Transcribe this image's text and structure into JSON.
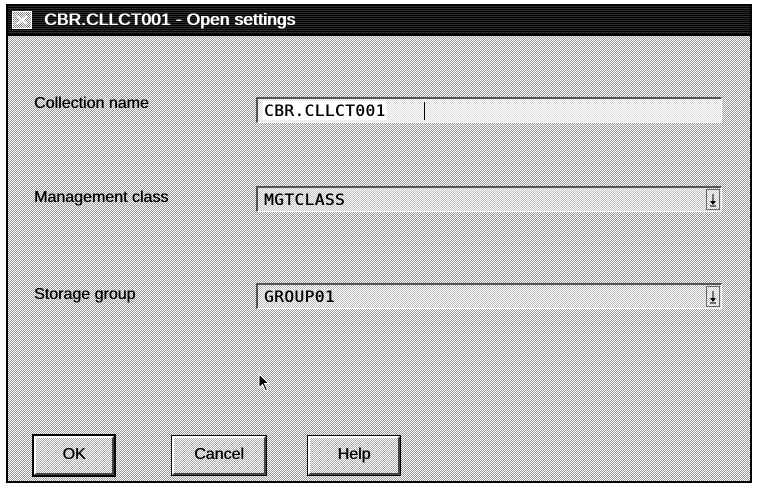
{
  "window": {
    "title": "CBR.CLLCT001 - Open settings"
  },
  "fields": {
    "collection_name": {
      "label": "Collection name",
      "value": "CBR.CLLCT001"
    },
    "management_class": {
      "label": "Management class",
      "value": "MGTCLASS"
    },
    "storage_group": {
      "label": "Storage group",
      "value": "GROUP01"
    }
  },
  "buttons": {
    "ok": "OK",
    "cancel": "Cancel",
    "help": "Help"
  },
  "icons": {
    "system_menu": "system-menu-icon",
    "dropdown": "dropdown-arrow-icon",
    "pointer": "mouse-pointer-icon"
  }
}
